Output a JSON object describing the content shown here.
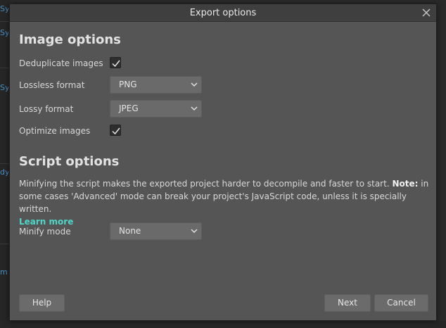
{
  "dialog": {
    "title": "Export options",
    "close_icon": "close-icon"
  },
  "image_options": {
    "heading": "Image options",
    "deduplicate_label": "Deduplicate images",
    "deduplicate_checked": true,
    "lossless_label": "Lossless format",
    "lossless_value": "PNG",
    "lossy_label": "Lossy format",
    "lossy_value": "JPEG",
    "optimize_label": "Optimize images",
    "optimize_checked": true
  },
  "script_options": {
    "heading": "Script options",
    "description_main": "Minifying the script makes the exported project harder to decompile and faster to start. ",
    "note_label": "Note:",
    "description_note": " in some cases 'Advanced' mode can break your project's JavaScript code, unless it is specially written.",
    "learn_more": "Learn more",
    "minify_label": "Minify mode",
    "minify_value": "None"
  },
  "footer": {
    "help_label": "Help",
    "next_label": "Next",
    "cancel_label": "Cancel"
  },
  "colors": {
    "dialog_bg": "#555555",
    "titlebar_bg": "#3f3f3f",
    "link": "#4fd6c8",
    "button_bg": "#6b6b6b"
  }
}
